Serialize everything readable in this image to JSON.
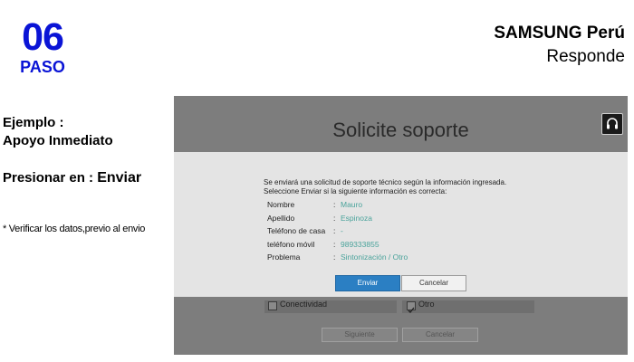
{
  "step": {
    "number": "06",
    "word": "PASO"
  },
  "brand": {
    "title": "SAMSUNG Perú",
    "subtitle": "Responde"
  },
  "instructions": {
    "line1": "Ejemplo :",
    "line2": "Apoyo Inmediato",
    "action_prefix": "Presionar en : ",
    "action_target": "Enviar",
    "note": "* Verificar los datos,previo al envio"
  },
  "screen": {
    "title": "Solicite soporte",
    "help_icon": "headset-icon",
    "background_options": [
      {
        "label": "Conectividad",
        "checked": false
      },
      {
        "label": "Otro",
        "checked": true
      }
    ],
    "background_buttons": {
      "next": "Siguiente",
      "cancel": "Cancelar"
    },
    "modal": {
      "message_line1": "Se enviará una solicitud de soporte técnico según la información ingresada.",
      "message_line2": "Seleccione Enviar si la siguiente información es correcta:",
      "fields": [
        {
          "label": "Nombre",
          "value": "Mauro"
        },
        {
          "label": "Apellido",
          "value": "Espinoza"
        },
        {
          "label": "Teléfono de casa",
          "value": "-"
        },
        {
          "label": "teléfono móvil",
          "value": "989333855"
        },
        {
          "label": "Problema",
          "value": "Sintonización / Otro"
        }
      ],
      "send_label": "Enviar",
      "cancel_label": "Cancelar",
      "accent_color": "#2b7fc3",
      "value_color": "#4aa39b"
    }
  }
}
